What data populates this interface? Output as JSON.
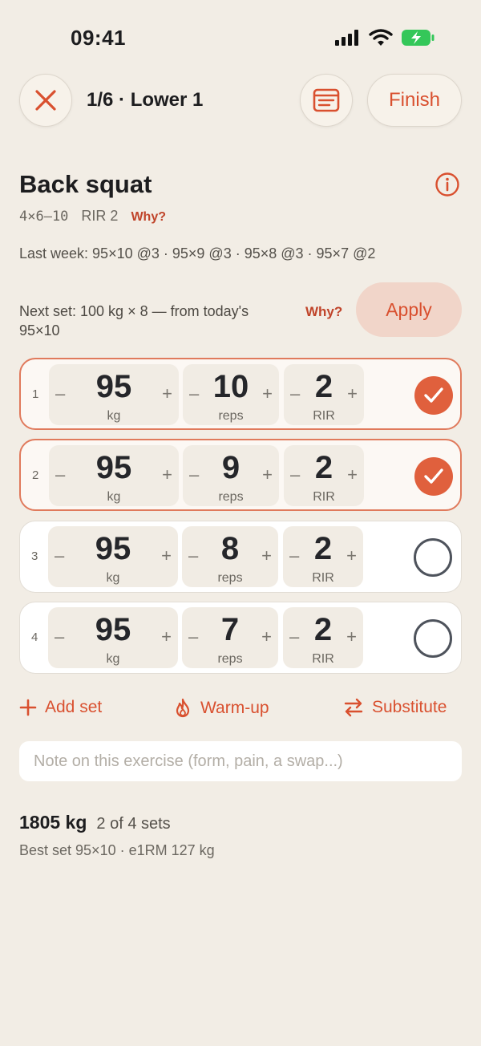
{
  "status": {
    "time": "09:41"
  },
  "header": {
    "workout_title": "1/6 · Lower 1",
    "finish_label": "Finish"
  },
  "exercise": {
    "name": "Back squat",
    "scheme": "4×6–10",
    "rir": "RIR 2",
    "why_label": "Why?",
    "last_week": "Last week: 95×10 @3 · 95×9 @3 · 95×8 @3 · 95×7 @2"
  },
  "suggestion": {
    "text": "Next set: 100 kg × 8 — from today's 95×10",
    "why_label": "Why?",
    "apply_label": "Apply"
  },
  "sets": [
    {
      "num": "1",
      "weight": "95",
      "weight_unit": "kg",
      "reps": "10",
      "reps_unit": "reps",
      "rir": "2",
      "rir_unit": "RIR",
      "done": true
    },
    {
      "num": "2",
      "weight": "95",
      "weight_unit": "kg",
      "reps": "9",
      "reps_unit": "reps",
      "rir": "2",
      "rir_unit": "RIR",
      "done": true
    },
    {
      "num": "3",
      "weight": "95",
      "weight_unit": "kg",
      "reps": "8",
      "reps_unit": "reps",
      "rir": "2",
      "rir_unit": "RIR",
      "done": false
    },
    {
      "num": "4",
      "weight": "95",
      "weight_unit": "kg",
      "reps": "7",
      "reps_unit": "reps",
      "rir": "2",
      "rir_unit": "RIR",
      "done": false
    }
  ],
  "stepper_symbols": {
    "minus": "–",
    "plus": "+"
  },
  "actions": {
    "add_set": "Add set",
    "warm_up": "Warm-up",
    "substitute": "Substitute"
  },
  "note": {
    "placeholder": "Note on this exercise (form, pain, a swap...)"
  },
  "summary": {
    "volume": "1805 kg",
    "progress": "2 of 4 sets",
    "best": "Best set 95×10 · e1RM 127 kg"
  },
  "colors": {
    "accent": "#d9502f",
    "background": "#f2ede5",
    "check_done": "#e0603d",
    "apply_bg": "#f1d5c9"
  }
}
